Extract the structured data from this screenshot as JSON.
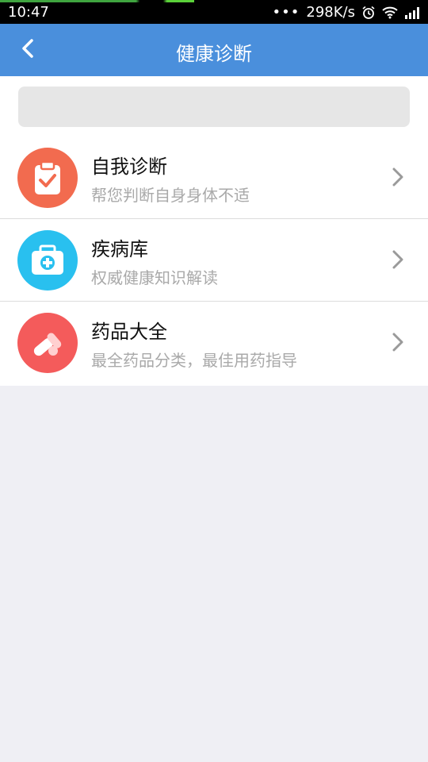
{
  "status_bar": {
    "time": "10:47",
    "network_speed": "298K/s",
    "more_label": "•••"
  },
  "header": {
    "title": "健康诊断"
  },
  "search": {
    "placeholder": ""
  },
  "menu": {
    "items": [
      {
        "title": "自我诊断",
        "subtitle": "帮您判断自身身体不适",
        "icon": "clipboard-check-icon",
        "color": "#f26b4f"
      },
      {
        "title": "疾病库",
        "subtitle": "权威健康知识解读",
        "icon": "medical-kit-icon",
        "color": "#29c0ef"
      },
      {
        "title": "药品大全",
        "subtitle": "最全药品分类，最佳用药指导",
        "icon": "pills-icon",
        "color": "#f45b5b"
      }
    ]
  }
}
